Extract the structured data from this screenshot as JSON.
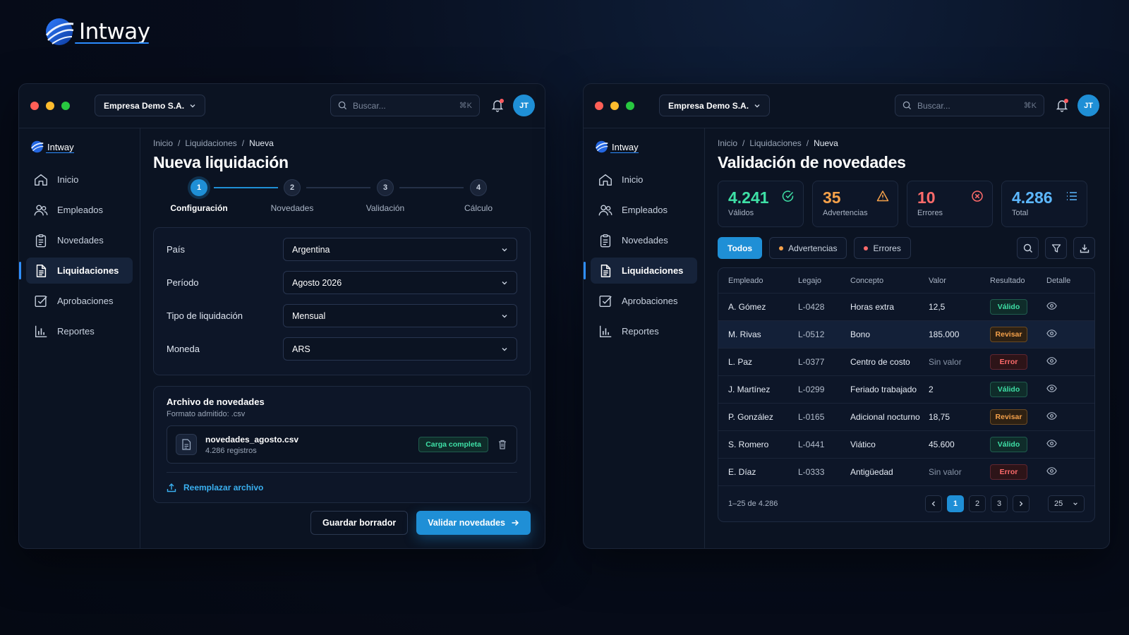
{
  "brand": {
    "name": "Intway"
  },
  "colors": {
    "accent": "#1f8fd6",
    "valid": "#3ee0a6",
    "warning": "#f5a14a",
    "error": "#ff6b6b",
    "background": "#070d1c"
  },
  "window_controls": [
    "#ff5f57",
    "#febc2e",
    "#28c840"
  ],
  "topbar": {
    "company": "Empresa Demo S.A.",
    "search_placeholder": "Buscar...",
    "shortcut": "⌘K",
    "avatar_initials": "JT"
  },
  "sidebar": {
    "logo": "Intway",
    "items": [
      {
        "label": "Inicio",
        "icon": "home-icon"
      },
      {
        "label": "Empleados",
        "icon": "users-icon"
      },
      {
        "label": "Novedades",
        "icon": "clipboard-icon"
      },
      {
        "label": "Liquidaciones",
        "icon": "document-icon",
        "active": true
      },
      {
        "label": "Aprobaciones",
        "icon": "check-square-icon"
      },
      {
        "label": "Reportes",
        "icon": "bar-chart-icon"
      }
    ]
  },
  "left": {
    "breadcrumb": [
      "Inicio",
      "Liquidaciones",
      "Nueva"
    ],
    "title": "Nueva liquidación",
    "steps": [
      {
        "n": "1",
        "label": "Configuración"
      },
      {
        "n": "2",
        "label": "Novedades"
      },
      {
        "n": "3",
        "label": "Validación"
      },
      {
        "n": "4",
        "label": "Cálculo"
      }
    ],
    "current_step": 1,
    "form": [
      {
        "label": "País",
        "value": "Argentina"
      },
      {
        "label": "Período",
        "value": "Agosto 2026"
      },
      {
        "label": "Tipo de liquidación",
        "value": "Mensual"
      },
      {
        "label": "Moneda",
        "value": "ARS"
      }
    ],
    "file": {
      "title": "Archivo de novedades",
      "subtitle": "Formato admitido: .csv",
      "name": "novedades_agosto.csv",
      "meta": "4.286 registros",
      "status": "Carga completa",
      "replace_label": "Reemplazar archivo"
    },
    "actions": {
      "save": "Guardar borrador",
      "validate": "Validar novedades"
    }
  },
  "right": {
    "breadcrumb": [
      "Inicio",
      "Liquidaciones",
      "Nueva"
    ],
    "title": "Validación de novedades",
    "stats": [
      {
        "value": "4.241",
        "label": "Válidos",
        "color": "#3ee0a6",
        "icon": "check-circle-icon"
      },
      {
        "value": "35",
        "label": "Advertencias",
        "color": "#f5a14a",
        "icon": "warning-icon"
      },
      {
        "value": "10",
        "label": "Errores",
        "color": "#ff6b6b",
        "icon": "x-circle-icon"
      },
      {
        "value": "4.286",
        "label": "Total",
        "color": "#5db8ff",
        "icon": "list-icon"
      }
    ],
    "filters": {
      "all": "Todos",
      "warnings": "Advertencias",
      "errors": "Errores"
    },
    "table": {
      "headers": [
        "Empleado",
        "Legajo",
        "Concepto",
        "Valor",
        "Resultado",
        "Detalle"
      ],
      "rows": [
        {
          "empleado": "A. Gómez",
          "legajo": "L-0428",
          "concepto": "Horas extra",
          "valor": "12,5",
          "resultado": "Válido",
          "kind": "v"
        },
        {
          "empleado": "M. Rivas",
          "legajo": "L-0512",
          "concepto": "Bono",
          "valor": "185.000",
          "resultado": "Revisar",
          "kind": "r"
        },
        {
          "empleado": "L. Paz",
          "legajo": "L-0377",
          "concepto": "Centro de costo",
          "valor": "Sin valor",
          "resultado": "Error",
          "kind": "e"
        },
        {
          "empleado": "J. Martínez",
          "legajo": "L-0299",
          "concepto": "Feriado trabajado",
          "valor": "2",
          "resultado": "Válido",
          "kind": "v"
        },
        {
          "empleado": "P. González",
          "legajo": "L-0165",
          "concepto": "Adicional nocturno",
          "valor": "18,75",
          "resultado": "Revisar",
          "kind": "r"
        },
        {
          "empleado": "S. Romero",
          "legajo": "L-0441",
          "concepto": "Viático",
          "valor": "45.600",
          "resultado": "Válido",
          "kind": "v"
        },
        {
          "empleado": "E. Díaz",
          "legajo": "L-0333",
          "concepto": "Antigüedad",
          "valor": "Sin valor",
          "resultado": "Error",
          "kind": "e"
        }
      ]
    },
    "pagination": {
      "summary": "1–25 de 4.286",
      "pages": [
        "1",
        "2",
        "3"
      ],
      "current": "1",
      "page_size": "25"
    }
  }
}
